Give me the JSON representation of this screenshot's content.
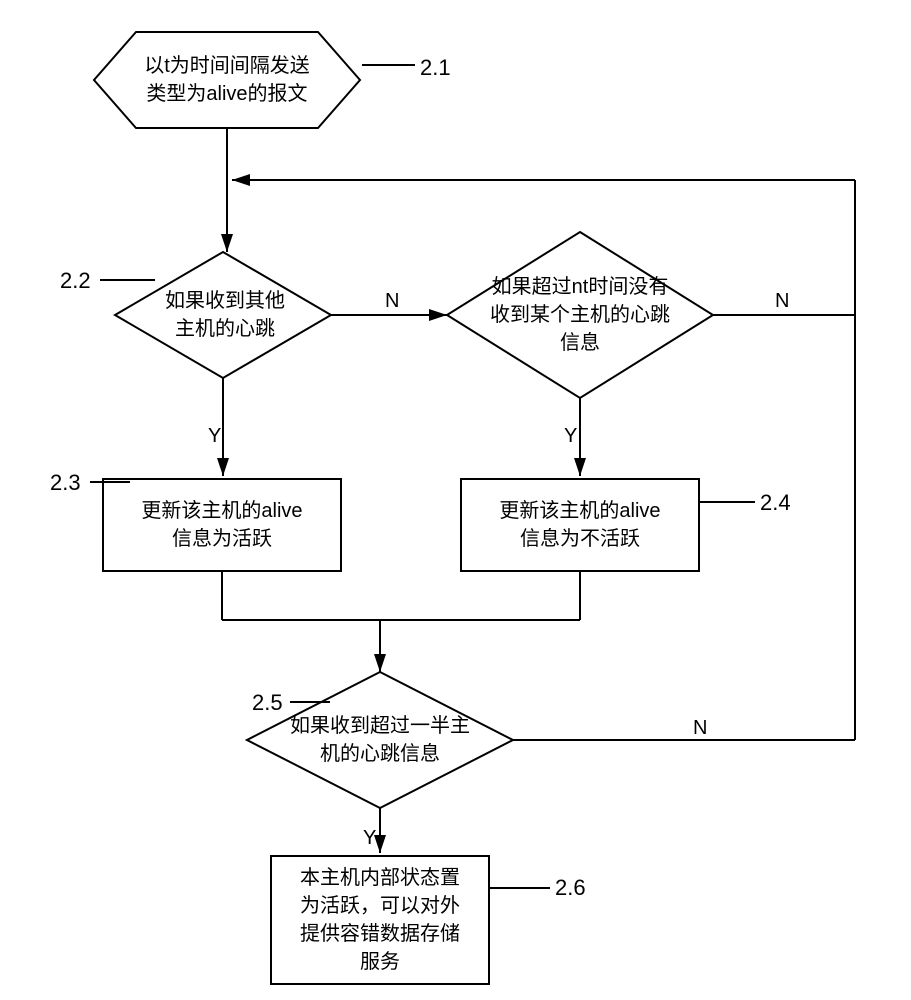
{
  "chart_data": {
    "type": "flowchart",
    "nodes": [
      {
        "id": "2.1",
        "shape": "hexagon",
        "text": "以t为时间间隔发送类型为alive的报文"
      },
      {
        "id": "2.2",
        "shape": "decision",
        "text": "如果收到其他主机的心跳"
      },
      {
        "id": "nt-check",
        "shape": "decision",
        "text": "如果超过nt时间没有收到某个主机的心跳信息"
      },
      {
        "id": "2.3",
        "shape": "process",
        "text": "更新该主机的alive信息为活跃"
      },
      {
        "id": "2.4",
        "shape": "process",
        "text": "更新该主机的alive信息为不活跃"
      },
      {
        "id": "2.5",
        "shape": "decision",
        "text": "如果收到超过一半主机的心跳信息"
      },
      {
        "id": "2.6",
        "shape": "process",
        "text": "本主机内部状态置为活跃，可以对外提供容错数据存储服务"
      }
    ],
    "edges": [
      {
        "from": "2.1",
        "to": "2.2"
      },
      {
        "from": "2.2",
        "to": "2.3",
        "label": "Y"
      },
      {
        "from": "2.2",
        "to": "nt-check",
        "label": "N"
      },
      {
        "from": "nt-check",
        "to": "2.4",
        "label": "Y"
      },
      {
        "from": "nt-check",
        "to": "loop-back",
        "label": "N"
      },
      {
        "from": "2.3",
        "to": "2.5"
      },
      {
        "from": "2.4",
        "to": "2.5"
      },
      {
        "from": "2.5",
        "to": "2.6",
        "label": "Y"
      },
      {
        "from": "2.5",
        "to": "loop-back",
        "label": "N"
      }
    ]
  },
  "nodes": {
    "n21": "以t为时间间隔发送\n类型为alive的报文",
    "n22": "如果收到其他\n主机的心跳",
    "nnt": "如果超过nt时间没有\n收到某个主机的心跳\n信息",
    "n23": "更新该主机的alive\n信息为活跃",
    "n24": "更新该主机的alive\n信息为不活跃",
    "n25": "如果收到超过一半主\n机的心跳信息",
    "n26": "本主机内部状态置\n为活跃，可以对外\n提供容错数据存储\n服务"
  },
  "labels": {
    "l21": "2.1",
    "l22": "2.2",
    "l23": "2.3",
    "l24": "2.4",
    "l25": "2.5",
    "l26": "2.6"
  },
  "edge_labels": {
    "y1": "Y",
    "n1": "N",
    "y2": "Y",
    "n2": "N",
    "y3": "Y",
    "n3": "N"
  }
}
